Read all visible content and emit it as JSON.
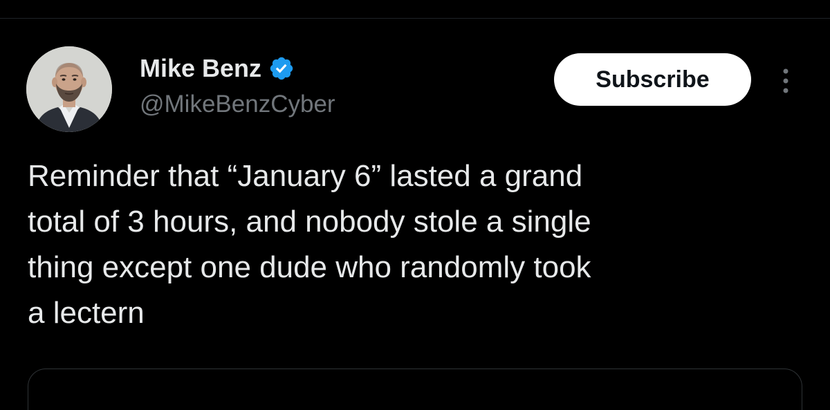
{
  "author": {
    "display_name": "Mike Benz",
    "handle": "@MikeBenzCyber",
    "verified": true,
    "avatar_icon": "profile-photo-man-in-suit",
    "verified_color": "#1d9bf0"
  },
  "actions": {
    "subscribe_label": "Subscribe",
    "more_icon": "more-vertical-icon"
  },
  "tweet": {
    "text": "Reminder that “January 6” lasted a grand\ntotal of 3 hours, and nobody stole a single\nthing except one dude who randomly took\na lectern"
  },
  "theme": {
    "background": "#000000",
    "text": "#e7e9ea",
    "secondary_text": "#71767b",
    "button_bg": "#ffffff",
    "button_text": "#0f1419"
  }
}
